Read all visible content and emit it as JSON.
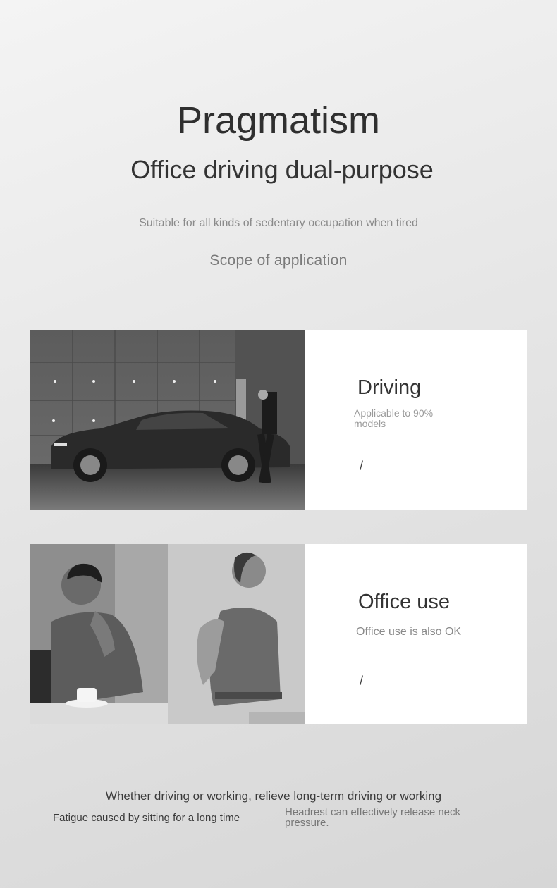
{
  "header": {
    "title": "Pragmatism",
    "subtitle": "Office driving dual-purpose",
    "tagline": "Suitable for all kinds of sedentary occupation when tired",
    "section_label": "Scope of application"
  },
  "cards": [
    {
      "title": "Driving",
      "desc": "Applicable to 90% models",
      "slash": "/",
      "image": "car-showroom-photo"
    },
    {
      "title": "Office use",
      "desc": "Office use is also OK",
      "slash": "/",
      "image": "office-workers-photo"
    }
  ],
  "footer": {
    "line1": "Whether driving or working, relieve long-term driving or working",
    "line2_left": "Fatigue caused by sitting for a long time",
    "line2_right": "Headrest can effectively release neck pressure."
  }
}
